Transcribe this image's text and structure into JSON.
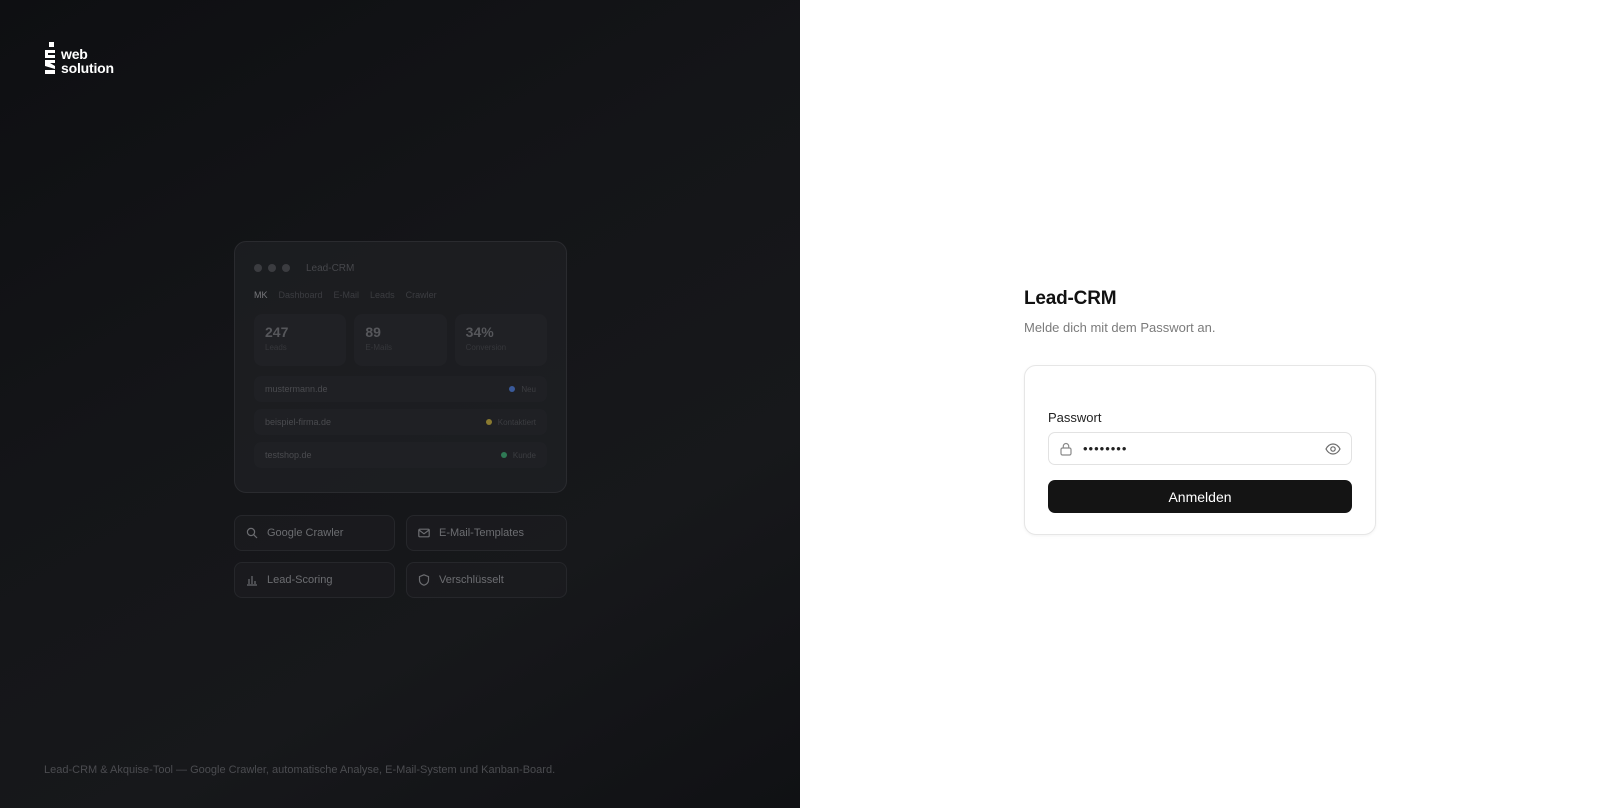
{
  "brand": {
    "line1": "web",
    "line2": "solution"
  },
  "preview": {
    "title": "Lead-CRM",
    "nav": [
      "MK",
      "Dashboard",
      "E-Mail",
      "Leads",
      "Crawler"
    ],
    "stats": [
      {
        "value": "247",
        "label": "Leads"
      },
      {
        "value": "89",
        "label": "E-Mails"
      },
      {
        "value": "34%",
        "label": "Conversion"
      }
    ],
    "rows": [
      {
        "domain": "mustermann.de",
        "status": "Neu",
        "color": "#3a5a9a"
      },
      {
        "domain": "beispiel-firma.de",
        "status": "Kontaktiert",
        "color": "#8a7a30"
      },
      {
        "domain": "testshop.de",
        "status": "Kunde",
        "color": "#2f7a55"
      }
    ]
  },
  "features": [
    {
      "label": "Google Crawler",
      "icon": "search-icon"
    },
    {
      "label": "E-Mail-Templates",
      "icon": "mail-icon"
    },
    {
      "label": "Lead-Scoring",
      "icon": "bar-chart-icon"
    },
    {
      "label": "Verschlüsselt",
      "icon": "shield-icon"
    }
  ],
  "tagline": "Lead-CRM & Akquise-Tool — Google Crawler, automatische Analyse, E-Mail-System und Kanban-Board.",
  "login": {
    "title": "Lead-CRM",
    "subtitle": "Melde dich mit dem Passwort an.",
    "password_label": "Passwort",
    "password_value": "••••••••",
    "submit_label": "Anmelden"
  },
  "colors": {
    "left_bg": "#141518",
    "button_bg": "#141414",
    "accent": "#111111"
  }
}
